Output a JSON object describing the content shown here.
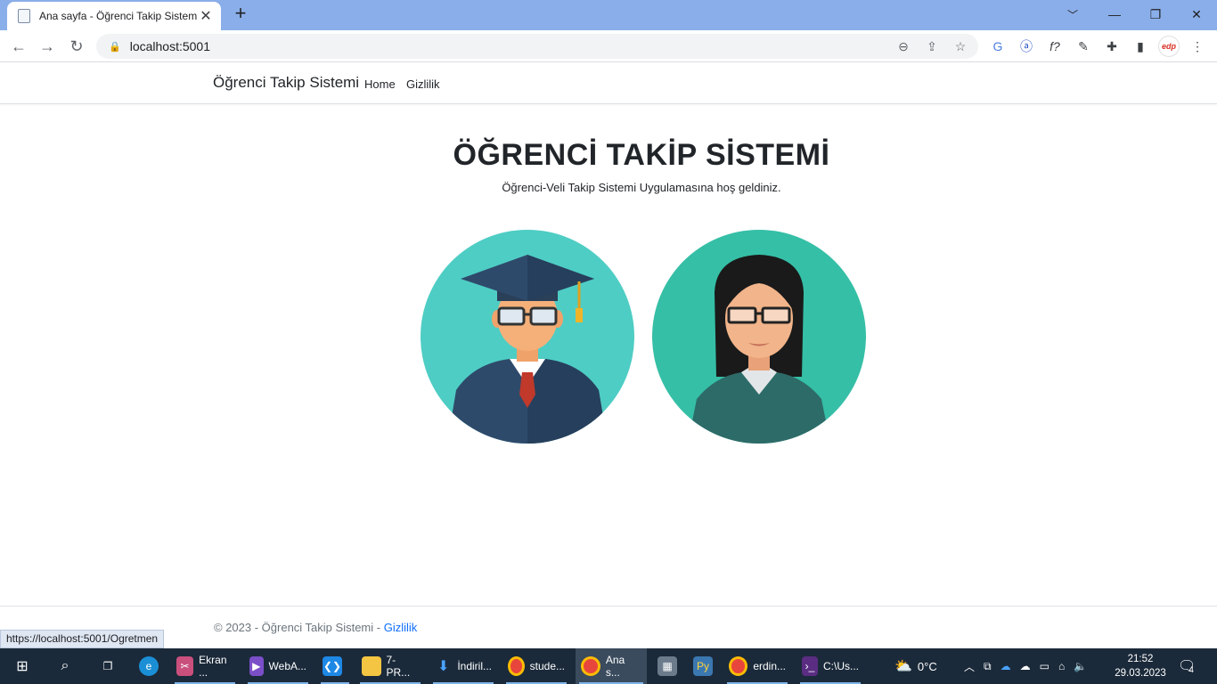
{
  "browser": {
    "tab_title": "Ana sayfa - Öğrenci Takip Sistemi",
    "url": "localhost:5001",
    "status_url": "https://localhost:5001/Ogretmen"
  },
  "site": {
    "brand": "Öğrenci Takip Sistemi",
    "nav": [
      "Home",
      "Gizlilik"
    ],
    "title": "ÖĞRENCİ TAKİP SİSTEMİ",
    "subtitle": "Öğrenci-Veli Takip Sistemi Uygulamasına hoş geldiniz.",
    "footer_text": "© 2023 - Öğrenci Takip Sistemi -",
    "footer_link": "Gizlilik"
  },
  "taskbar": {
    "apps": [
      {
        "label": "Ekran ...",
        "icon": "snip-icon"
      },
      {
        "label": "WebA...",
        "icon": "visual-studio-icon"
      },
      {
        "label": "",
        "icon": "vscode-icon"
      },
      {
        "label": "7-PR...",
        "icon": "folder-icon"
      },
      {
        "label": "İndiril...",
        "icon": "download-icon"
      },
      {
        "label": "stude...",
        "icon": "chrome-icon"
      },
      {
        "label": "Ana s...",
        "icon": "chrome-icon"
      },
      {
        "label": "",
        "icon": "calculator-icon"
      },
      {
        "label": "",
        "icon": "python-icon"
      },
      {
        "label": "erdin...",
        "icon": "chrome-icon"
      },
      {
        "label": "C:\\Us...",
        "icon": "terminal-icon"
      }
    ],
    "weather": "0°C",
    "time": "21:52",
    "date": "29.03.2023",
    "notifications": "4"
  },
  "colors": {
    "tabstrip": "#8aaee9",
    "link": "#0d6efd",
    "taskbar": "#1b2a3a"
  }
}
